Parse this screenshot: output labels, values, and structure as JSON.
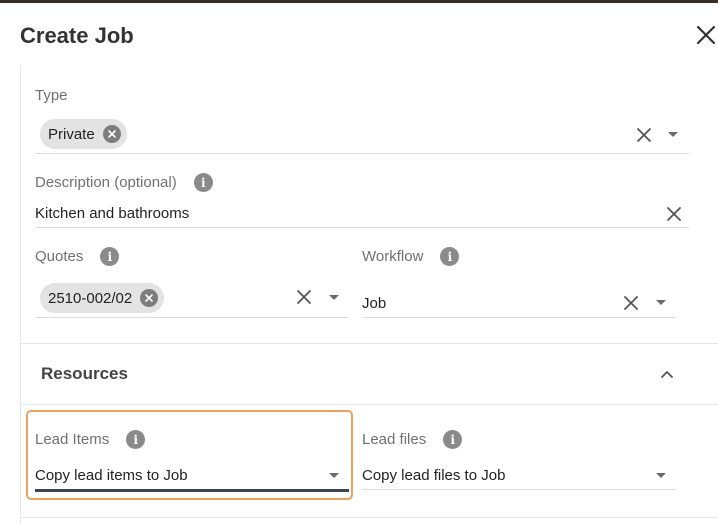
{
  "dialog": {
    "title": "Create Job",
    "close_icon": "close-icon"
  },
  "form": {
    "type": {
      "label": "Type",
      "chips": [
        "Private"
      ],
      "input_value": ""
    },
    "description": {
      "label": "Description (optional)",
      "value": "Kitchen and bathrooms"
    },
    "quotes": {
      "label": "Quotes",
      "chips": [
        "2510-002/02"
      ],
      "input_value": ""
    },
    "workflow": {
      "label": "Workflow",
      "value": "Job"
    }
  },
  "resources": {
    "title": "Resources",
    "lead_items": {
      "label": "Lead Items",
      "value": "Copy lead items to Job"
    },
    "lead_files": {
      "label": "Lead files",
      "value": "Copy lead files to Job"
    }
  },
  "colors": {
    "focus_outline": "#f2a05d",
    "chip_bg": "#e3e3e3",
    "active_underline": "#3e4552"
  }
}
